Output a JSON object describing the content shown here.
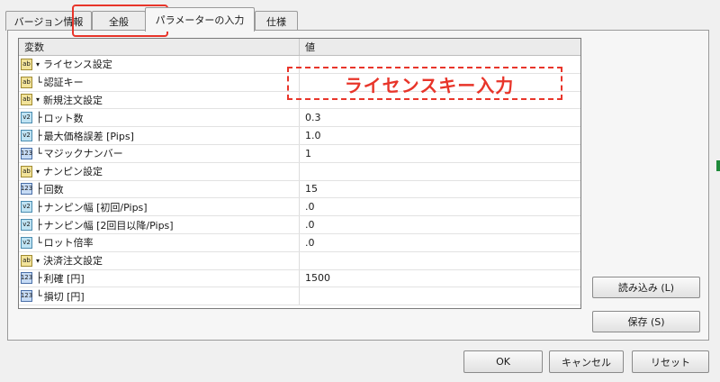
{
  "tabs": [
    {
      "label": "バージョン情報",
      "active": false
    },
    {
      "label": "全般",
      "active": false
    },
    {
      "label": "パラメーターの入力",
      "active": true
    },
    {
      "label": "仕様",
      "active": false
    }
  ],
  "grid": {
    "headers": {
      "variable": "変数",
      "value": "値"
    },
    "rows": [
      {
        "icon": "ab",
        "prefix": "▾",
        "name": "ライセンス設定",
        "value": ""
      },
      {
        "icon": "ab",
        "prefix": "└",
        "name": "認証キー",
        "value": ""
      },
      {
        "icon": "ab",
        "prefix": "▾",
        "name": "新規注文設定",
        "value": ""
      },
      {
        "icon": "v2",
        "prefix": "├",
        "name": "ロット数",
        "value": "0.3"
      },
      {
        "icon": "v2",
        "prefix": "├",
        "name": "最大価格誤差 [Pips]",
        "value": "1.0"
      },
      {
        "icon": "123",
        "prefix": "└",
        "name": "マジックナンバー",
        "value": "1"
      },
      {
        "icon": "ab",
        "prefix": "▾",
        "name": "ナンピン設定",
        "value": ""
      },
      {
        "icon": "123",
        "prefix": "├",
        "name": "回数",
        "value": "15"
      },
      {
        "icon": "v2",
        "prefix": "├",
        "name": "ナンピン幅 [初回/Pips]",
        "value": ".0"
      },
      {
        "icon": "v2",
        "prefix": "├",
        "name": "ナンピン幅 [2回目以降/Pips]",
        "value": ".0"
      },
      {
        "icon": "v2",
        "prefix": "└",
        "name": "ロット倍率",
        "value": ".0"
      },
      {
        "icon": "ab",
        "prefix": "▾",
        "name": "決済注文設定",
        "value": ""
      },
      {
        "icon": "123",
        "prefix": "├",
        "name": "利確 [円]",
        "value": "1500"
      },
      {
        "icon": "123",
        "prefix": "└",
        "name": "損切 [円]",
        "value": ""
      }
    ]
  },
  "annotation": {
    "text": "ライセンスキー入力",
    "color": "#e8352a"
  },
  "buttons": {
    "load": "読み込み (L)",
    "save": "保存 (S)",
    "ok": "OK",
    "cancel": "キャンセル",
    "reset": "リセット"
  }
}
